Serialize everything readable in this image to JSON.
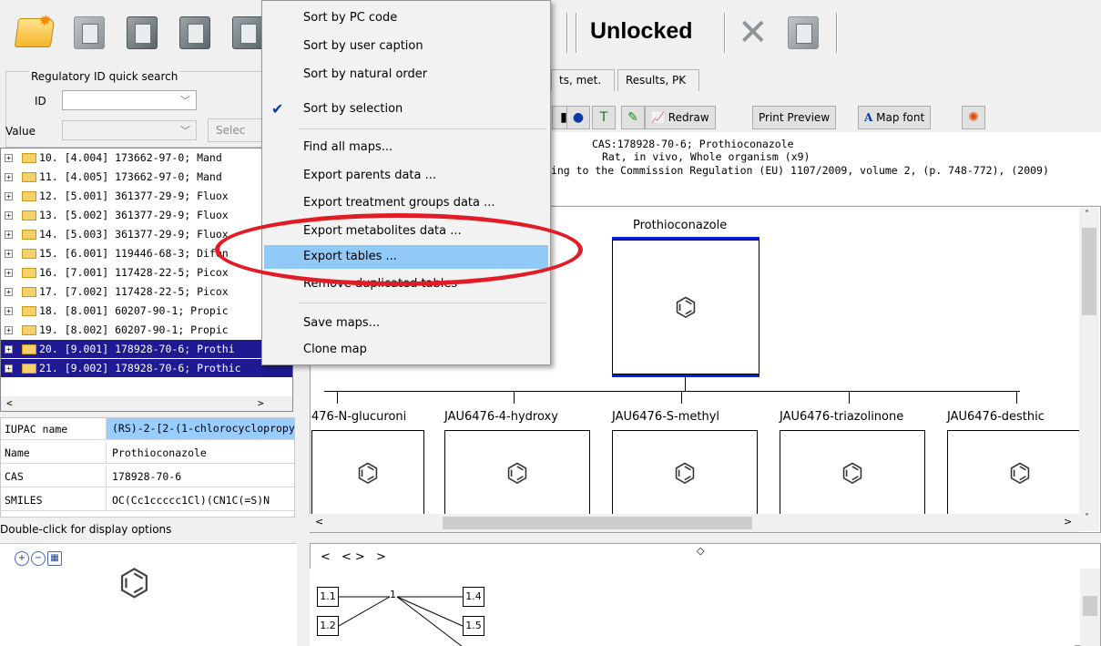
{
  "toolbar": {
    "lock_status": "Unlocked",
    "icons": [
      "open-folder-icon",
      "map-icon",
      "map-icon",
      "map-icon",
      "map-icon",
      "close-x-icon",
      "map-icon"
    ]
  },
  "quick_search": {
    "title": "Regulatory ID quick search",
    "id_label": "ID",
    "id_value": "",
    "value_label": "Value",
    "value_value": "",
    "select_button": "Selec"
  },
  "tree": {
    "items": [
      {
        "label": "10. [4.004] 173662-97-0; Mand",
        "selected": false
      },
      {
        "label": "11. [4.005] 173662-97-0; Mand",
        "selected": false
      },
      {
        "label": "12. [5.001] 361377-29-9; Fluox",
        "selected": false
      },
      {
        "label": "13. [5.002] 361377-29-9; Fluox",
        "selected": false
      },
      {
        "label": "14. [5.003] 361377-29-9; Fluox",
        "selected": false
      },
      {
        "label": "15. [6.001] 119446-68-3; Difen",
        "selected": false
      },
      {
        "label": "16. [7.001] 117428-22-5; Picox",
        "selected": false
      },
      {
        "label": "17. [7.002] 117428-22-5; Picox",
        "selected": false
      },
      {
        "label": "18. [8.001] 60207-90-1; Propic",
        "selected": false
      },
      {
        "label": "19. [8.002] 60207-90-1; Propic",
        "selected": false
      },
      {
        "label": "20. [9.001] 178928-70-6; Prothi",
        "selected": true
      },
      {
        "label": "21. [9.002] 178928-70-6; Prothic",
        "selected": true
      }
    ]
  },
  "properties": [
    {
      "key": "IUPAC name",
      "value": "(RS)-2-[2-(1-chlorocyclopropy"
    },
    {
      "key": "Name",
      "value": "Prothioconazole"
    },
    {
      "key": "CAS",
      "value": "178928-70-6"
    },
    {
      "key": "SMILES",
      "value": "OC(Cc1ccccc1Cl)(CN1C(=S)N"
    }
  ],
  "hint": "Double-click for display options",
  "tabs": [
    "ts, met.",
    "Results, PK"
  ],
  "right_toolbar": {
    "redraw": "Redraw",
    "print_preview": "Print Preview",
    "map_font": "Map font"
  },
  "info": {
    "line1": "CAS:178928-70-6;  Prothioconazole",
    "line2": "Rat, in vivo, Whole organism (x9)",
    "line3": "ding to the Commission Regulation (EU) 1107/2009, volume 2, (p. 748-772), (2009)"
  },
  "map": {
    "parent": "Prothioconazole",
    "metabolites": [
      "476-N-glucuroni",
      "JAU6476-4-hydroxy",
      "JAU6476-S-methyl",
      "JAU6476-triazolinone",
      "JAU6476-desthic"
    ]
  },
  "lower": {
    "nav": "<  <>  >",
    "nodes": [
      "1.1",
      "1.2",
      "1.4",
      "1.5"
    ],
    "root": "1"
  },
  "context_menu": {
    "items": [
      {
        "label": "Sort by PC code"
      },
      {
        "label": "Sort by user caption"
      },
      {
        "label": "Sort by natural order"
      },
      {
        "label": "Sort by selection",
        "checked": true
      },
      {
        "label": "Find all maps..."
      },
      {
        "label": "Export parents data ..."
      },
      {
        "label": "Export treatment groups data ..."
      },
      {
        "label": "Export metabolites data ..."
      },
      {
        "label": "Export tables ...",
        "highlighted": true
      },
      {
        "label": "Remove duplicated tables"
      },
      {
        "label": "Save maps..."
      },
      {
        "label": "Clone map"
      }
    ]
  },
  "colors": {
    "selection": "#1f1a91",
    "menu_hover": "#91c9f7",
    "annotation": "#e21b25",
    "highlight_cell": "#99ccff"
  }
}
